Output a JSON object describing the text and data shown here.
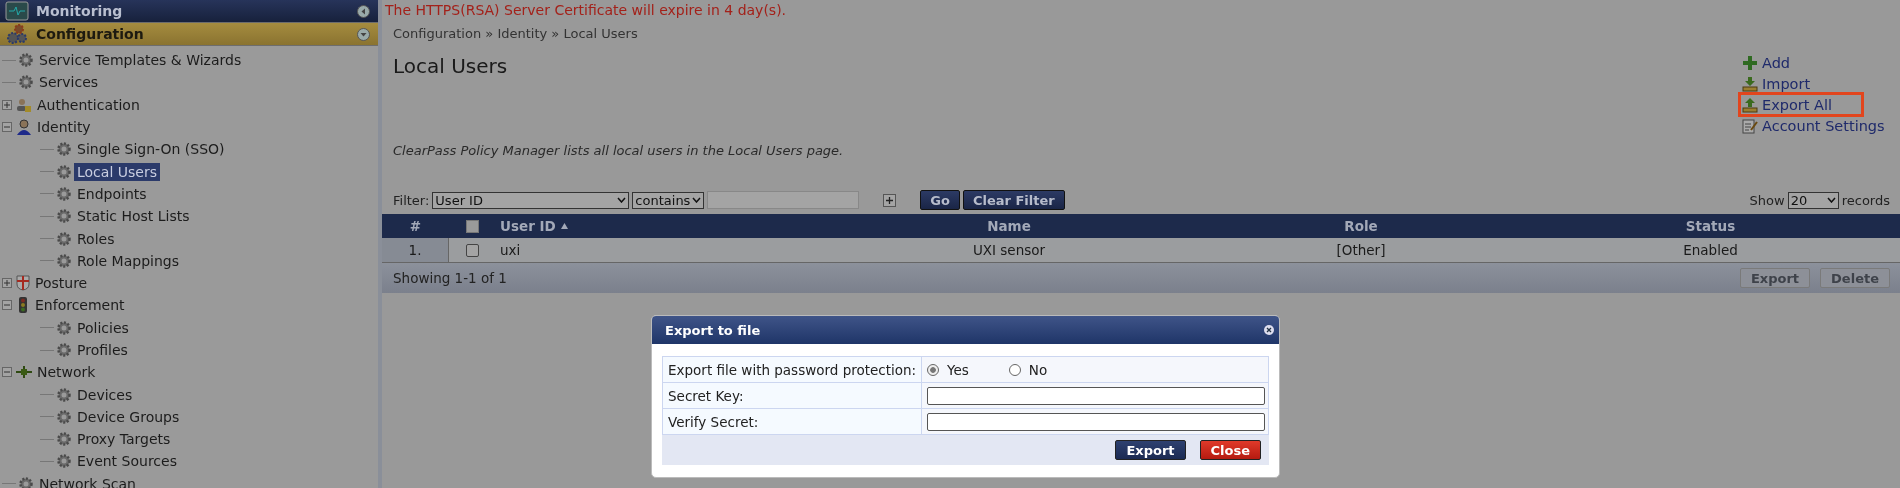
{
  "sidebar": {
    "sections": [
      {
        "label": "Monitoring",
        "expanded": false
      },
      {
        "label": "Configuration",
        "expanded": true
      }
    ],
    "tree": [
      {
        "label": "Service Templates & Wizards",
        "kind": "gear",
        "selected": false
      },
      {
        "label": "Services",
        "kind": "gear",
        "selected": false
      },
      {
        "label": "Authentication",
        "kind": "auth",
        "selected": false,
        "expanded": false
      },
      {
        "label": "Identity",
        "kind": "identity",
        "selected": false,
        "expanded": true,
        "children": [
          {
            "label": "Single Sign-On (SSO)",
            "kind": "gear",
            "selected": false
          },
          {
            "label": "Local Users",
            "kind": "gear",
            "selected": true
          },
          {
            "label": "Endpoints",
            "kind": "gear",
            "selected": false
          },
          {
            "label": "Static Host Lists",
            "kind": "gear",
            "selected": false
          },
          {
            "label": "Roles",
            "kind": "gear",
            "selected": false
          },
          {
            "label": "Role Mappings",
            "kind": "gear",
            "selected": false
          }
        ]
      },
      {
        "label": "Posture",
        "kind": "posture",
        "selected": false,
        "expanded": false
      },
      {
        "label": "Enforcement",
        "kind": "enforcement",
        "selected": false,
        "expanded": true,
        "children": [
          {
            "label": "Policies",
            "kind": "gear",
            "selected": false
          },
          {
            "label": "Profiles",
            "kind": "gear",
            "selected": false
          }
        ]
      },
      {
        "label": "Network",
        "kind": "network",
        "selected": false,
        "expanded": true,
        "children": [
          {
            "label": "Devices",
            "kind": "gear",
            "selected": false
          },
          {
            "label": "Device Groups",
            "kind": "gear",
            "selected": false
          },
          {
            "label": "Proxy Targets",
            "kind": "gear",
            "selected": false
          },
          {
            "label": "Event Sources",
            "kind": "gear",
            "selected": false
          }
        ]
      },
      {
        "label": "Network Scan",
        "kind": "gear",
        "selected": false
      }
    ]
  },
  "warning": "The HTTPS(RSA) Server Certificate will expire in 4 day(s).",
  "breadcrumb": "Configuration » Identity » Local Users",
  "title": "Local Users",
  "description": "ClearPass Policy Manager lists all local users in the Local Users page.",
  "actions": [
    {
      "label": "Add",
      "kind": "add",
      "highlighted": false
    },
    {
      "label": "Import",
      "kind": "import",
      "highlighted": false
    },
    {
      "label": "Export All",
      "kind": "export",
      "highlighted": true
    },
    {
      "label": "Account Settings",
      "kind": "settings",
      "highlighted": false
    }
  ],
  "filter": {
    "label": "Filter:",
    "field": "User ID",
    "operator": "contains",
    "go": "Go",
    "clear": "Clear Filter"
  },
  "page_size": {
    "label": "Show",
    "value": "20",
    "suffix": "records"
  },
  "table": {
    "select_all": false,
    "columns": [
      {
        "label": "#",
        "sorted": false
      },
      {
        "kind": "checkbox",
        "sorted": false
      },
      {
        "label": "User ID",
        "sorted": true
      },
      {
        "label": "Name",
        "sorted": false
      },
      {
        "label": "Role",
        "sorted": false
      },
      {
        "label": "Status",
        "sorted": false
      }
    ],
    "rows": [
      {
        "index": "1.",
        "checked": false,
        "user_id": "uxi",
        "name": "UXI sensor",
        "role": "[Other]",
        "status": "Enabled"
      }
    ]
  },
  "footer": {
    "summary": "Showing 1-1 of 1",
    "buttons": [
      {
        "label": "Export",
        "disabled": true
      },
      {
        "label": "Delete",
        "disabled": true
      }
    ]
  },
  "dialog": {
    "title": "Export to file",
    "protection": {
      "label": "Export file with password protection:",
      "options": [
        {
          "label": "Yes",
          "selected": true
        },
        {
          "label": "No",
          "selected": false
        }
      ]
    },
    "fields": [
      {
        "label": "Secret Key:"
      },
      {
        "label": "Verify Secret:"
      }
    ],
    "buttons": [
      {
        "label": "Export",
        "kind": "primary"
      },
      {
        "label": "Close",
        "kind": "danger"
      }
    ]
  }
}
